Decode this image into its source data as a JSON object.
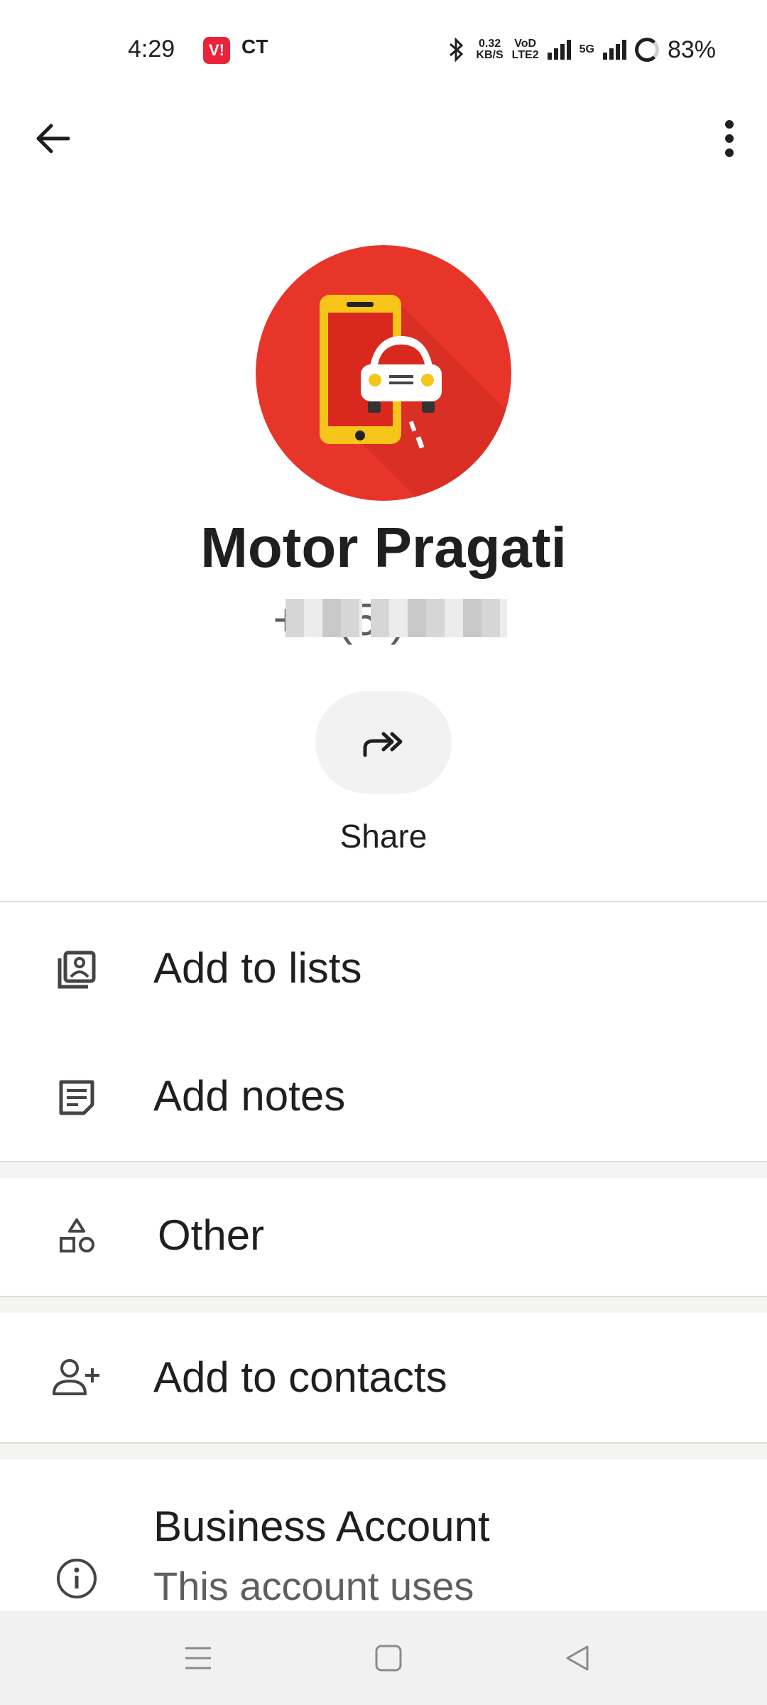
{
  "status_bar": {
    "time": "4:29",
    "carrier1": "V!",
    "carrier2": "CT",
    "net_speed_top": "0.32",
    "net_speed_bottom": "KB/S",
    "volte_top": "VoD",
    "volte_bottom": "LTE2",
    "network": "5G",
    "battery": "83%"
  },
  "contact": {
    "name": "Motor Pragati",
    "phone": "+1 (5    )          794"
  },
  "actions": {
    "share_label": "Share"
  },
  "menu": {
    "add_to_lists": "Add to lists",
    "add_notes": "Add notes",
    "other": "Other",
    "add_to_contacts": "Add to contacts",
    "business_title": "Business Account",
    "business_sub": "This account uses"
  },
  "colors": {
    "avatar_bg": "#e8352a",
    "phone_yellow": "#f7c51a",
    "accent_text": "#1f1f1f"
  },
  "icons": {
    "back": "arrow-left-icon",
    "more": "more-vertical-icon",
    "share": "share-forward-icon",
    "lists": "contact-list-icon",
    "notes": "note-icon",
    "other": "shapes-icon",
    "add_contact": "person-add-icon",
    "info": "info-icon"
  }
}
